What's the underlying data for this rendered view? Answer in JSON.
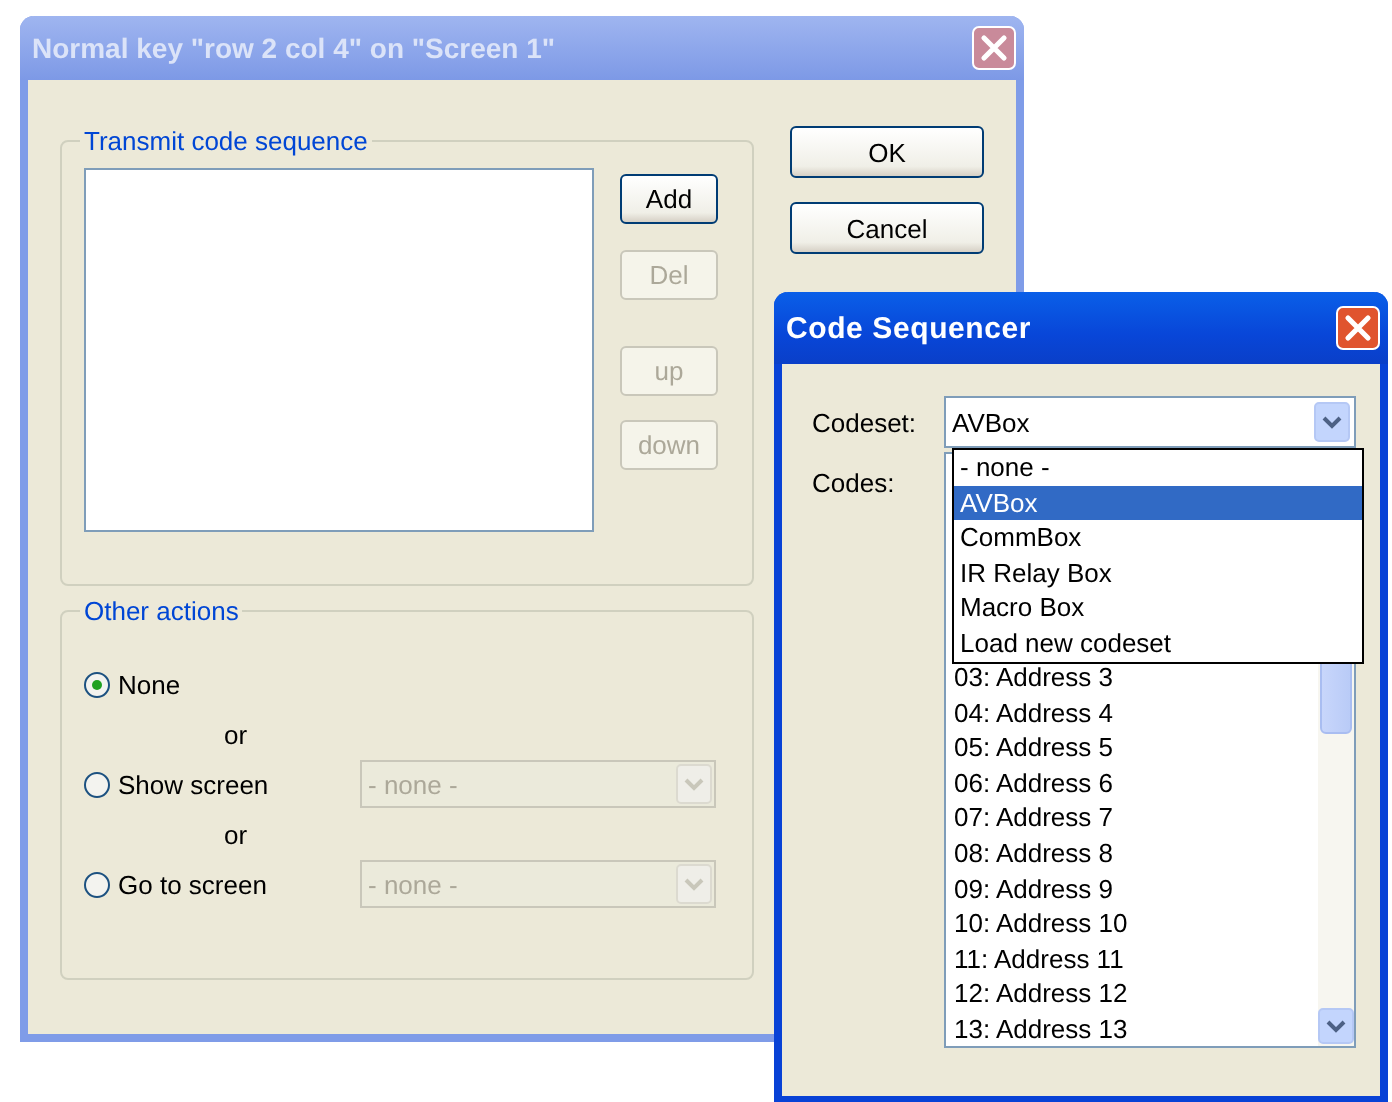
{
  "dialog": {
    "title": "Normal key \"row 2 col 4\" on \"Screen 1\"",
    "active": false,
    "sequence_group": {
      "label": "Transmit code sequence",
      "buttons": [
        {
          "label": "Add",
          "disabled": false
        },
        {
          "label": "Del",
          "disabled": true
        },
        {
          "label": "up",
          "disabled": true
        },
        {
          "label": "down",
          "disabled": true
        }
      ]
    },
    "buttons": [
      "OK",
      "Cancel"
    ],
    "actions_group": {
      "label": "Other actions",
      "options": [
        {
          "label": "None",
          "selected": true
        },
        {
          "prefix": "or",
          "label": "Show screen",
          "selected": false,
          "select": {
            "value": "- none -",
            "disabled": true
          }
        },
        {
          "prefix": "or",
          "label": "Go to screen",
          "selected": false,
          "select": {
            "value": "- none -",
            "disabled": true
          }
        }
      ]
    }
  },
  "sequencer": {
    "title": "Code Sequencer",
    "active": true,
    "codeset_label": "Codeset:",
    "codeset_value": "AVBox",
    "codes_label": "Codes:",
    "dropdown_options": [
      {
        "label": "- none -",
        "selected": false
      },
      {
        "label": "AVBox",
        "selected": true
      },
      {
        "label": "CommBox",
        "selected": false
      },
      {
        "label": "IR Relay Box",
        "selected": false
      },
      {
        "label": "Macro Box",
        "selected": false
      },
      {
        "label": "Load new codeset",
        "selected": false
      }
    ],
    "codes": [
      "03: Address 3",
      "04: Address 4",
      "05: Address 5",
      "06: Address 6",
      "07: Address 7",
      "08: Address 8",
      "09: Address 9",
      "10: Address 10",
      "11: Address 11",
      "12: Address 12",
      "13: Address 13"
    ]
  }
}
